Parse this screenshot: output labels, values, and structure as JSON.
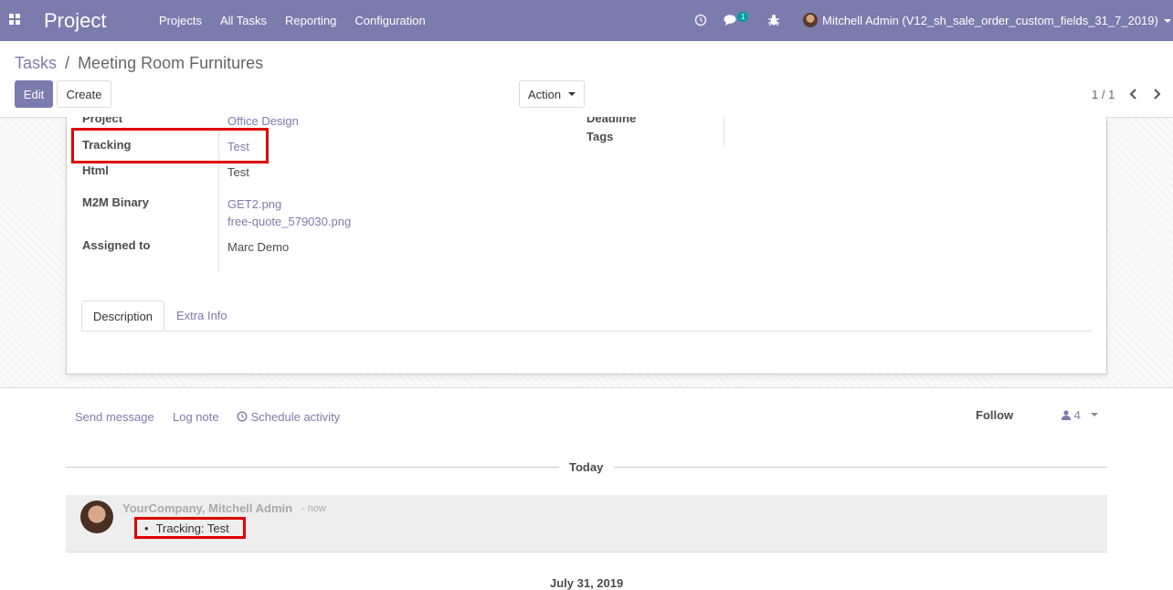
{
  "navbar": {
    "app_title": "Project",
    "menu": [
      "Projects",
      "All Tasks",
      "Reporting",
      "Configuration"
    ],
    "chat_badge": "1",
    "user_name": "Mitchell Admin (V12_sh_sale_order_custom_fields_31_7_2019)"
  },
  "breadcrumb": {
    "parent": "Tasks",
    "separator": "/",
    "current": "Meeting Room Furnitures"
  },
  "buttons": {
    "edit": "Edit",
    "create": "Create",
    "action": "Action"
  },
  "pager": {
    "value": "1 / 1"
  },
  "form": {
    "project_label": "Project",
    "project_value": "Office Design",
    "tracking_label": "Tracking",
    "tracking_value": "Test",
    "html_label": "Html",
    "html_value": "Test",
    "m2m_label": "M2M Binary",
    "m2m_files": [
      "GET2.png",
      "free-quote_579030.png"
    ],
    "assigned_label": "Assigned to",
    "assigned_value": "Marc Demo",
    "deadline_label": "Deadline",
    "tags_label": "Tags"
  },
  "tabs": [
    "Description",
    "Extra Info"
  ],
  "chatter": {
    "send_message": "Send message",
    "log_note": "Log note",
    "schedule_activity": "Schedule activity",
    "follow": "Follow",
    "followers_count": "4",
    "day_separator": "Today",
    "message_author": "YourCompany, Mitchell Admin",
    "message_time": "- now",
    "message_body": "Tracking: Test",
    "next_day_separator": "July 31, 2019"
  },
  "colors": {
    "brand": "#7c7bad",
    "highlight": "#e00000",
    "badge": "#00a09d"
  }
}
